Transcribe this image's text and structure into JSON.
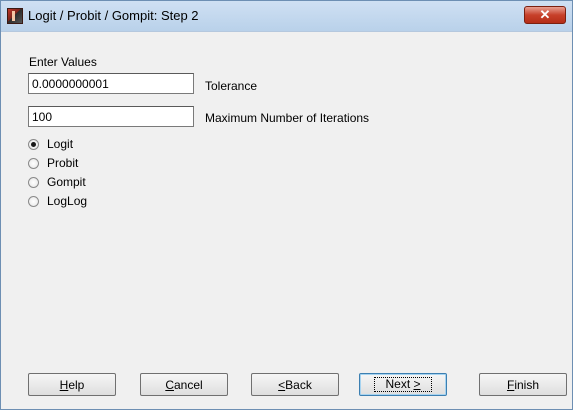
{
  "window": {
    "title": "Logit / Probit / Gompit: Step 2",
    "close_glyph": "✕",
    "icon": "app-icon"
  },
  "group": {
    "label": "Enter Values"
  },
  "fields": [
    {
      "value": "0.0000000001",
      "label": "Tolerance"
    },
    {
      "value": "100",
      "label": "Maximum Number of Iterations"
    }
  ],
  "model_options": [
    {
      "label": "Logit",
      "checked": true
    },
    {
      "label": "Probit",
      "checked": false
    },
    {
      "label": "Gompit",
      "checked": false
    },
    {
      "label": "LogLog",
      "checked": false
    }
  ],
  "buttons": {
    "help": {
      "accel": "H",
      "rest": "elp"
    },
    "cancel": {
      "accel": "C",
      "rest": "ancel"
    },
    "back": {
      "accel": "<",
      "rest": " Back"
    },
    "next": {
      "pre": "Next ",
      "accel": ">"
    },
    "finish": {
      "accel": "F",
      "rest": "inish"
    }
  }
}
